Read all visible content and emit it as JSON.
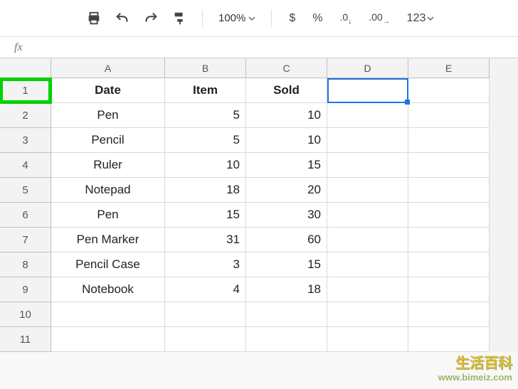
{
  "toolbar": {
    "zoom": "100%",
    "more_formats": "123"
  },
  "formula_bar": {
    "label": "fx",
    "value": ""
  },
  "columns": [
    "A",
    "B",
    "C",
    "D",
    "E"
  ],
  "selected_cell": "D1",
  "highlighted_row_header": 1,
  "headers": {
    "A": "Date",
    "B": "Item",
    "C": "Sold"
  },
  "rows": [
    {
      "n": 1,
      "A": "Date",
      "B": "Item",
      "C": "Sold",
      "is_header": true
    },
    {
      "n": 2,
      "A": "Pen",
      "B": "5",
      "C": "10"
    },
    {
      "n": 3,
      "A": "Pencil",
      "B": "5",
      "C": "10"
    },
    {
      "n": 4,
      "A": "Ruler",
      "B": "10",
      "C": "15"
    },
    {
      "n": 5,
      "A": "Notepad",
      "B": "18",
      "C": "20"
    },
    {
      "n": 6,
      "A": "Pen",
      "B": "15",
      "C": "30"
    },
    {
      "n": 7,
      "A": "Pen Marker",
      "B": "31",
      "C": "60"
    },
    {
      "n": 8,
      "A": "Pencil Case",
      "B": "3",
      "C": "15"
    },
    {
      "n": 9,
      "A": "Notebook",
      "B": "4",
      "C": "18"
    },
    {
      "n": 10,
      "A": "",
      "B": "",
      "C": ""
    },
    {
      "n": 11,
      "A": "",
      "B": "",
      "C": ""
    }
  ],
  "watermark": {
    "cn": "生活百科",
    "url": "www.bimeiz.com"
  },
  "chart_data": {
    "type": "table",
    "columns": [
      "Date",
      "Item",
      "Sold"
    ],
    "data": [
      [
        "Pen",
        5,
        10
      ],
      [
        "Pencil",
        5,
        10
      ],
      [
        "Ruler",
        10,
        15
      ],
      [
        "Notepad",
        18,
        20
      ],
      [
        "Pen",
        15,
        30
      ],
      [
        "Pen Marker",
        31,
        60
      ],
      [
        "Pencil Case",
        3,
        15
      ],
      [
        "Notebook",
        4,
        18
      ]
    ]
  }
}
